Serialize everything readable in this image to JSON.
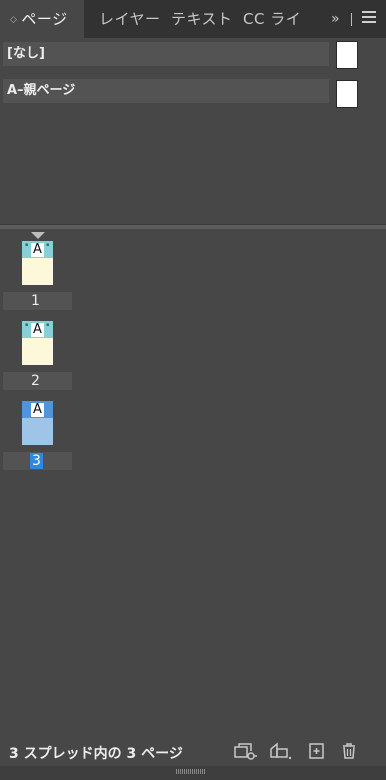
{
  "tabs": [
    {
      "label": "ページ",
      "active": true
    },
    {
      "label": "レイヤー",
      "active": false
    },
    {
      "label": "テキスト",
      "active": false
    },
    {
      "label": "CC ライ",
      "active": false
    }
  ],
  "tab_overflow": "»",
  "masters": [
    {
      "label": "[なし]"
    },
    {
      "label": "A–親ページ"
    }
  ],
  "pages": [
    {
      "number": "1",
      "master_letter": "A",
      "selected": false
    },
    {
      "number": "2",
      "master_letter": "A",
      "selected": false
    },
    {
      "number": "3",
      "master_letter": "A",
      "selected": true
    }
  ],
  "status_text": "3 スプレッド内の 3 ページ",
  "footer_icons": [
    "edit-page-size-icon",
    "create-new-page-options-icon",
    "new-page-icon",
    "delete-page-icon"
  ],
  "colors": {
    "panel_bg": "#474747",
    "tabbar_bg": "#323232",
    "selection": "#2f87e0"
  }
}
